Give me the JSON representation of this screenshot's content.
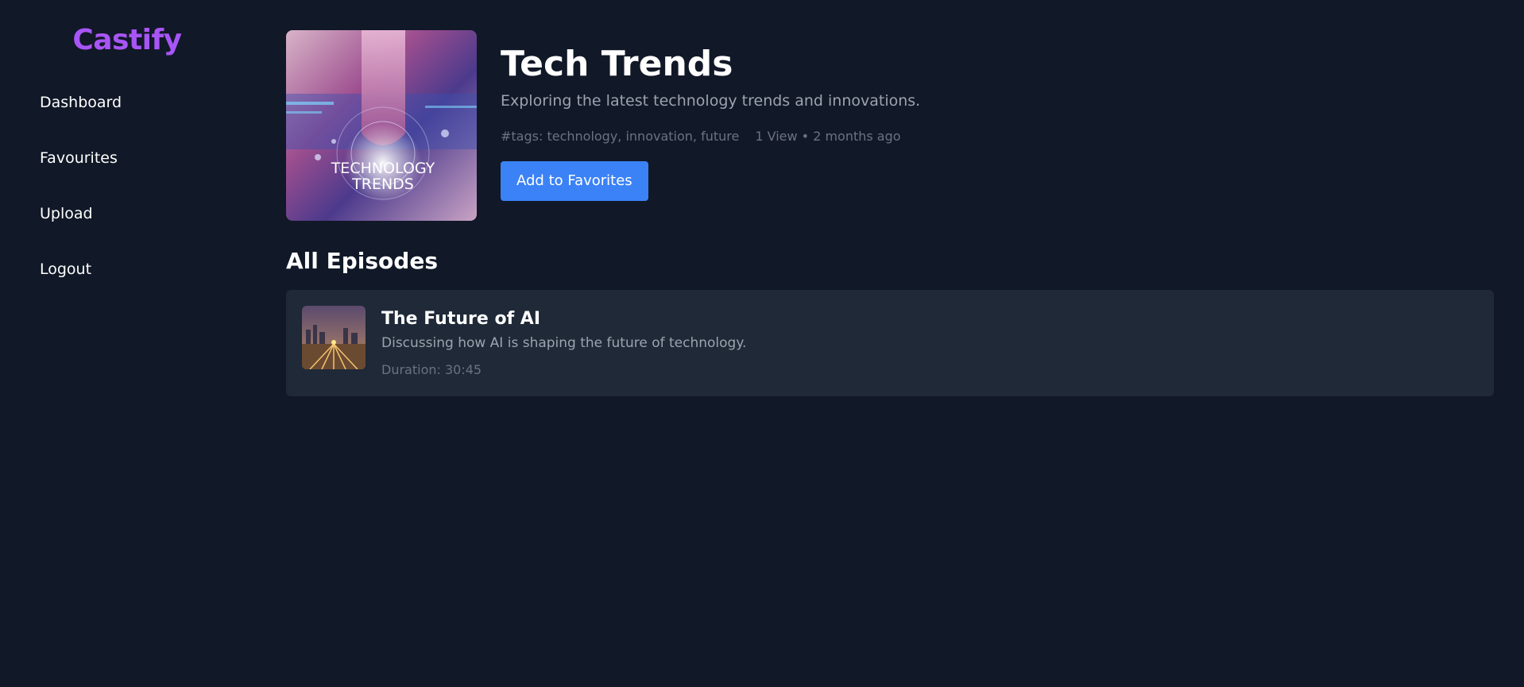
{
  "sidebar": {
    "brand": "Castify",
    "items": [
      {
        "label": "Dashboard"
      },
      {
        "label": "Favourites"
      },
      {
        "label": "Upload"
      },
      {
        "label": "Logout"
      }
    ]
  },
  "podcast": {
    "cover_text_line1": "TECHNOLOGY",
    "cover_text_line2": "TRENDS",
    "title": "Tech Trends",
    "description": "Exploring the latest technology trends and innovations.",
    "tags": "#tags: technology, innovation, future",
    "stats": "1 View • 2 months ago",
    "favorite_button": "Add to Favorites"
  },
  "episodes_section": {
    "title": "All Episodes",
    "episodes": [
      {
        "title": "The Future of AI",
        "description": "Discussing how AI is shaping the future of technology.",
        "duration": "Duration: 30:45"
      }
    ]
  },
  "colors": {
    "background": "#111827",
    "card": "#1f2937",
    "brand": "#a855f7",
    "accent": "#3b82f6"
  }
}
